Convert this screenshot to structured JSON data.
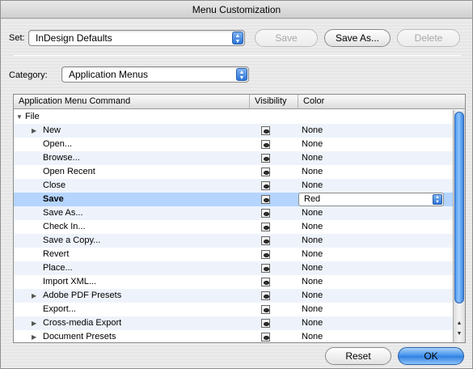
{
  "window": {
    "title": "Menu Customization"
  },
  "set": {
    "label": "Set:",
    "value": "InDesign Defaults",
    "buttons": {
      "save": "Save",
      "save_as": "Save As...",
      "delete": "Delete"
    }
  },
  "category": {
    "label": "Category:",
    "value": "Application Menus"
  },
  "table": {
    "columns": [
      "Application Menu Command",
      "Visibility",
      "Color"
    ],
    "rows": [
      {
        "label": "File",
        "indent": 0,
        "expander": "open",
        "visible": false,
        "color": ""
      },
      {
        "label": "New",
        "indent": 1,
        "expander": "closed",
        "visible": true,
        "color": "None"
      },
      {
        "label": "Open...",
        "indent": 1,
        "expander": "",
        "visible": true,
        "color": "None"
      },
      {
        "label": "Browse...",
        "indent": 1,
        "expander": "",
        "visible": true,
        "color": "None"
      },
      {
        "label": "Open Recent",
        "indent": 1,
        "expander": "",
        "visible": true,
        "color": "None"
      },
      {
        "label": "Close",
        "indent": 1,
        "expander": "",
        "visible": true,
        "color": "None"
      },
      {
        "label": "Save",
        "indent": 1,
        "expander": "",
        "visible": true,
        "color": "Red",
        "selected": true
      },
      {
        "label": "Save As...",
        "indent": 1,
        "expander": "",
        "visible": true,
        "color": "None"
      },
      {
        "label": "Check In...",
        "indent": 1,
        "expander": "",
        "visible": true,
        "color": "None"
      },
      {
        "label": "Save a Copy...",
        "indent": 1,
        "expander": "",
        "visible": true,
        "color": "None"
      },
      {
        "label": "Revert",
        "indent": 1,
        "expander": "",
        "visible": true,
        "color": "None"
      },
      {
        "label": "Place...",
        "indent": 1,
        "expander": "",
        "visible": true,
        "color": "None"
      },
      {
        "label": "Import XML...",
        "indent": 1,
        "expander": "",
        "visible": true,
        "color": "None"
      },
      {
        "label": "Adobe PDF Presets",
        "indent": 1,
        "expander": "closed",
        "visible": true,
        "color": "None"
      },
      {
        "label": "Export...",
        "indent": 1,
        "expander": "",
        "visible": true,
        "color": "None"
      },
      {
        "label": "Cross-media Export",
        "indent": 1,
        "expander": "closed",
        "visible": true,
        "color": "None"
      },
      {
        "label": "Document Presets",
        "indent": 1,
        "expander": "closed",
        "visible": true,
        "color": "None"
      }
    ]
  },
  "footer": {
    "reset": "Reset",
    "ok": "OK"
  },
  "colors": {
    "accent": "#3c8ee8",
    "selection": "#b5d5ff",
    "alt_row": "#eef3fb"
  }
}
